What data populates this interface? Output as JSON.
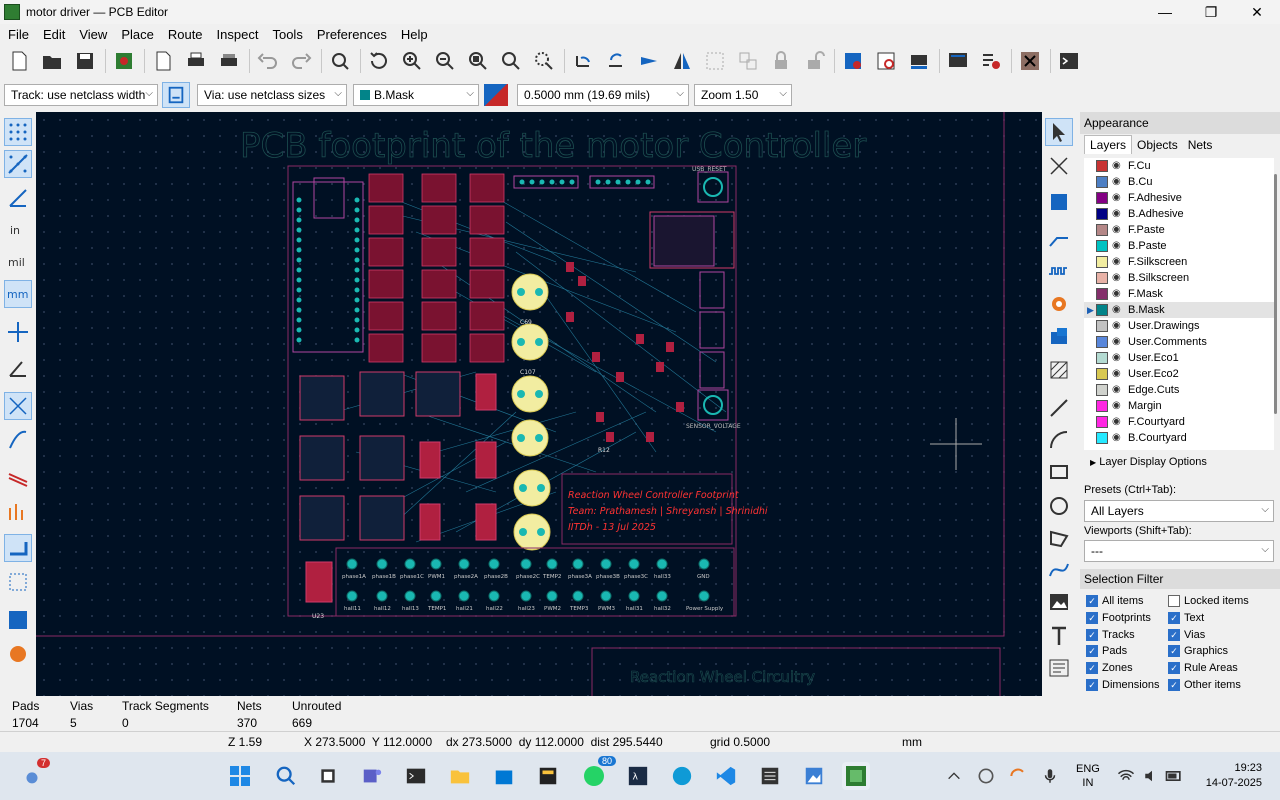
{
  "window": {
    "title": "motor driver — PCB Editor",
    "min": "—",
    "max": "❐",
    "close": "✕"
  },
  "menu": [
    "File",
    "Edit",
    "View",
    "Place",
    "Route",
    "Inspect",
    "Tools",
    "Preferences",
    "Help"
  ],
  "toolbar2": {
    "track": "Track: use netclass width",
    "via": "Via: use netclass sizes",
    "layer": "B.Mask",
    "grid": "0.5000 mm (19.69 mils)",
    "zoom": "Zoom 1.50"
  },
  "board": {
    "title": "PCB footprint of the motor Controller",
    "info_lines": [
      "Reaction Wheel Controller Footprint",
      "Team: Prathamesh | Shreyansh | Shrinidhi",
      "IITDh - 13 Jul 2025"
    ],
    "bottom_title": "Reaction Wheel Circuitry",
    "labels": {
      "usb_reset": "USB_RESET",
      "sensor_voltage": "SENSOR_VOLTAGE",
      "c69": "C69",
      "c107": "C107",
      "r12": "R12",
      "u23": "U23"
    },
    "pad_labels_row1": [
      "phase1A",
      "phase1B",
      "phase1C",
      "PWM1",
      "phase2A",
      "phase2B",
      "phase2C",
      "TEMP2",
      "phase3A",
      "phase3B",
      "phase3C",
      "hall33",
      "GND"
    ],
    "pad_labels_row2": [
      "hall11",
      "hall12",
      "hall13",
      "TEMP1",
      "hall21",
      "hall22",
      "hall23",
      "PWM2",
      "TEMP3",
      "PWM3",
      "hall31",
      "hall32",
      "Power Supply"
    ]
  },
  "appearance": {
    "header": "Appearance",
    "tabs": [
      "Layers",
      "Objects",
      "Nets"
    ],
    "layers": [
      {
        "name": "F.Cu",
        "color": "#c83434"
      },
      {
        "name": "B.Cu",
        "color": "#4d7fc4"
      },
      {
        "name": "F.Adhesive",
        "color": "#840084"
      },
      {
        "name": "B.Adhesive",
        "color": "#000084"
      },
      {
        "name": "F.Paste",
        "color": "#b48787"
      },
      {
        "name": "B.Paste",
        "color": "#00c2c2"
      },
      {
        "name": "F.Silkscreen",
        "color": "#f2eda1"
      },
      {
        "name": "B.Silkscreen",
        "color": "#e8b2a7"
      },
      {
        "name": "F.Mask",
        "color": "#842f6b"
      },
      {
        "name": "B.Mask",
        "color": "#028489"
      },
      {
        "name": "User.Drawings",
        "color": "#c2c2c2"
      },
      {
        "name": "User.Comments",
        "color": "#5987db"
      },
      {
        "name": "User.Eco1",
        "color": "#b4dbd2"
      },
      {
        "name": "User.Eco2",
        "color": "#d8c852"
      },
      {
        "name": "Edge.Cuts",
        "color": "#d0d2cd"
      },
      {
        "name": "Margin",
        "color": "#ff26e2"
      },
      {
        "name": "F.Courtyard",
        "color": "#ff26e2"
      },
      {
        "name": "B.Courtyard",
        "color": "#26e9ff"
      }
    ],
    "layer_display_options": "Layer Display Options",
    "presets_label": "Presets (Ctrl+Tab):",
    "presets_value": "All Layers",
    "viewports_label": "Viewports (Shift+Tab):",
    "viewports_value": "---",
    "selection_filter": "Selection Filter",
    "filters_left": [
      {
        "label": "All items",
        "on": true
      },
      {
        "label": "Footprints",
        "on": true
      },
      {
        "label": "Tracks",
        "on": true
      },
      {
        "label": "Pads",
        "on": true
      },
      {
        "label": "Zones",
        "on": true
      },
      {
        "label": "Dimensions",
        "on": true
      }
    ],
    "filters_right": [
      {
        "label": "Locked items",
        "on": false
      },
      {
        "label": "Text",
        "on": true
      },
      {
        "label": "Vias",
        "on": true
      },
      {
        "label": "Graphics",
        "on": true
      },
      {
        "label": "Rule Areas",
        "on": true
      },
      {
        "label": "Other items",
        "on": true
      }
    ]
  },
  "stats": {
    "headers": [
      "Pads",
      "Vias",
      "Track Segments",
      "Nets",
      "Unrouted"
    ],
    "values": [
      "1704",
      "5",
      "0",
      "370",
      "669"
    ]
  },
  "statusbar": {
    "zoom": "Z 1.59",
    "coords": "X 273.5000  Y 112.0000",
    "delta": "dx 273.5000  dy 112.0000  dist 295.5440",
    "grid": "grid 0.5000",
    "units": "mm"
  },
  "taskbar": {
    "weather_badge": "7",
    "whatsapp_badge": "80",
    "lang1": "ENG",
    "lang2": "IN",
    "time": "19:23",
    "date": "14-07-2025"
  }
}
